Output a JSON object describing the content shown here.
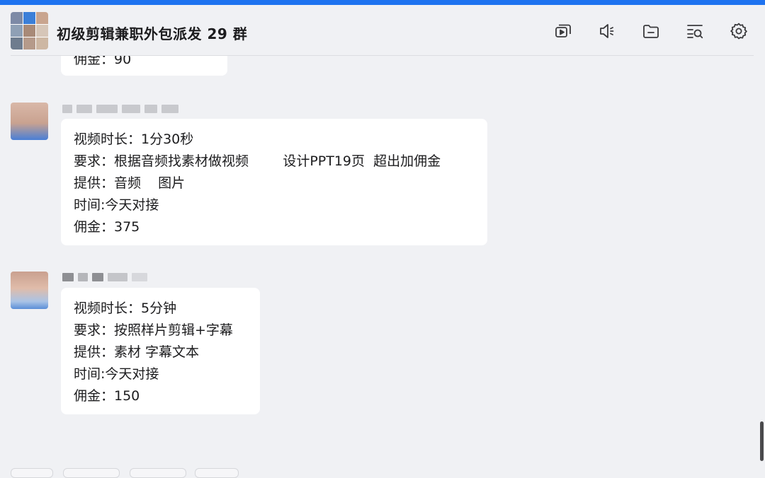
{
  "chat": {
    "title": "初级剪辑兼职外包派发 29 群"
  },
  "header_icons": [
    "video-play-icon",
    "speaker-icon",
    "folder-icon",
    "search-list-icon",
    "gear-icon"
  ],
  "messages": [
    {
      "lines": [
        "佣金：90"
      ]
    },
    {
      "lines": [
        "视频时长：1分30秒",
        "要求：根据音频找素材做视频        设计PPT19页  超出加佣金",
        "提供：音频    图片",
        "时间:今天对接",
        "佣金：375"
      ]
    },
    {
      "lines": [
        "视频时长：5分钟",
        "要求：按照样片剪辑+字幕",
        "提供：素材 字幕文本",
        "时间:今天对接",
        "佣金：150"
      ]
    }
  ],
  "colors": {
    "accent": "#1e73f0",
    "background": "#f0f1f4",
    "bubble": "#ffffff"
  }
}
